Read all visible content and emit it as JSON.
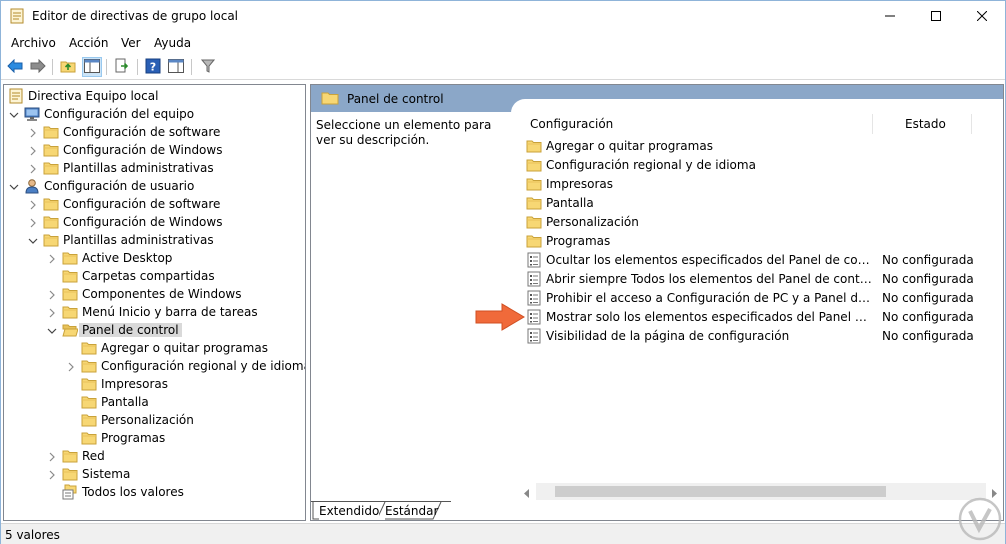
{
  "window": {
    "title": "Editor de directivas de grupo local"
  },
  "menu": [
    "Archivo",
    "Acción",
    "Ver",
    "Ayuda"
  ],
  "tree": [
    {
      "label": "Directiva Equipo local",
      "depth": 0,
      "expander": "none",
      "icon": "policy-doc"
    },
    {
      "label": "Configuración del equipo",
      "depth": 1,
      "expander": "open",
      "icon": "computer"
    },
    {
      "label": "Configuración de software",
      "depth": 2,
      "expander": "closed",
      "icon": "folder"
    },
    {
      "label": "Configuración de Windows",
      "depth": 2,
      "expander": "closed",
      "icon": "folder"
    },
    {
      "label": "Plantillas administrativas",
      "depth": 2,
      "expander": "closed",
      "icon": "folder"
    },
    {
      "label": "Configuración de usuario",
      "depth": 1,
      "expander": "open",
      "icon": "user"
    },
    {
      "label": "Configuración de software",
      "depth": 2,
      "expander": "closed",
      "icon": "folder"
    },
    {
      "label": "Configuración de Windows",
      "depth": 2,
      "expander": "closed",
      "icon": "folder"
    },
    {
      "label": "Plantillas administrativas",
      "depth": 2,
      "expander": "open",
      "icon": "folder"
    },
    {
      "label": "Active Desktop",
      "depth": 3,
      "expander": "closed",
      "icon": "folder"
    },
    {
      "label": "Carpetas compartidas",
      "depth": 3,
      "expander": "none",
      "icon": "folder"
    },
    {
      "label": "Componentes de Windows",
      "depth": 3,
      "expander": "closed",
      "icon": "folder"
    },
    {
      "label": "Menú Inicio y barra de tareas",
      "depth": 3,
      "expander": "closed",
      "icon": "folder"
    },
    {
      "label": "Panel de control",
      "depth": 3,
      "expander": "open",
      "icon": "folder-open",
      "selected": true
    },
    {
      "label": "Agregar o quitar programas",
      "depth": 4,
      "expander": "none",
      "icon": "folder"
    },
    {
      "label": "Configuración regional y de idioma",
      "depth": 4,
      "expander": "closed",
      "icon": "folder"
    },
    {
      "label": "Impresoras",
      "depth": 4,
      "expander": "none",
      "icon": "folder"
    },
    {
      "label": "Pantalla",
      "depth": 4,
      "expander": "none",
      "icon": "folder"
    },
    {
      "label": "Personalización",
      "depth": 4,
      "expander": "none",
      "icon": "folder"
    },
    {
      "label": "Programas",
      "depth": 4,
      "expander": "none",
      "icon": "folder"
    },
    {
      "label": "Red",
      "depth": 3,
      "expander": "closed",
      "icon": "folder"
    },
    {
      "label": "Sistema",
      "depth": 3,
      "expander": "closed",
      "icon": "folder"
    },
    {
      "label": "Todos los valores",
      "depth": 3,
      "expander": "none",
      "icon": "folder-stack"
    }
  ],
  "right": {
    "header": "Panel de control",
    "description": "Seleccione un elemento para ver su descripción.",
    "columns": {
      "name": "Configuración",
      "state": "Estado"
    },
    "rows": [
      {
        "name": "Agregar o quitar programas",
        "state": "",
        "icon": "folder"
      },
      {
        "name": "Configuración regional y de idioma",
        "state": "",
        "icon": "folder"
      },
      {
        "name": "Impresoras",
        "state": "",
        "icon": "folder"
      },
      {
        "name": "Pantalla",
        "state": "",
        "icon": "folder"
      },
      {
        "name": "Personalización",
        "state": "",
        "icon": "folder"
      },
      {
        "name": "Programas",
        "state": "",
        "icon": "folder"
      },
      {
        "name": "Ocultar los elementos especificados del Panel de control",
        "state": "No configurada",
        "icon": "setting"
      },
      {
        "name": "Abrir siempre Todos los elementos del Panel de control al a...",
        "state": "No configurada",
        "icon": "setting"
      },
      {
        "name": "Prohibir el acceso a Configuración de PC y a Panel de control",
        "state": "No configurada",
        "icon": "setting"
      },
      {
        "name": "Mostrar solo los elementos especificados del Panel de control",
        "state": "No configurada",
        "icon": "setting"
      },
      {
        "name": "Visibilidad de la página de configuración",
        "state": "No configurada",
        "icon": "setting"
      }
    ],
    "tabs": [
      "Extendido",
      "Estándar"
    ]
  },
  "status": "5 valores",
  "colors": {
    "accent": "#8ba7c8",
    "folder": "#f7d774",
    "arrow": "#f06a3a"
  }
}
